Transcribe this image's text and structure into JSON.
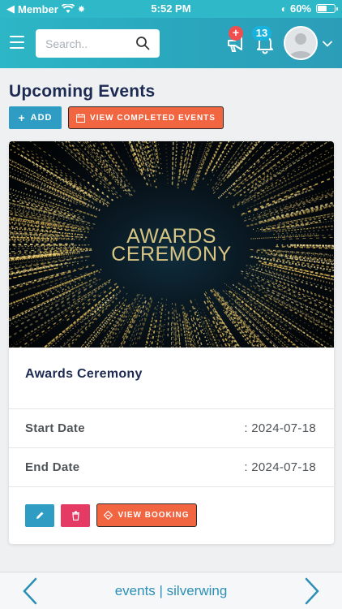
{
  "status_bar": {
    "carrier": "Member",
    "time": "5:52 PM",
    "battery": "60%",
    "battery_level": 0.6
  },
  "header": {
    "search_placeholder": "Search..",
    "megaphone_badge": "+",
    "bell_badge": "13"
  },
  "page": {
    "title": "Upcoming Events",
    "add_label": "ADD",
    "completed_label": "VIEW COMPLETED EVENTS"
  },
  "event": {
    "banner_line1": "AWARDS",
    "banner_line2": "CEREMONY",
    "name": "Awards Ceremony",
    "start_label": "Start Date",
    "start_value": ": 2024-07-18",
    "end_label": "End Date",
    "end_value": ": 2024-07-18",
    "booking_label": "VIEW BOOKING"
  },
  "bottom_bar": {
    "title": "events | silverwing"
  },
  "colors": {
    "header": "#2cb6c6",
    "primary": "#2f9cc4",
    "accent": "#f26541",
    "danger": "#e43a63",
    "title": "#1d2b52"
  }
}
